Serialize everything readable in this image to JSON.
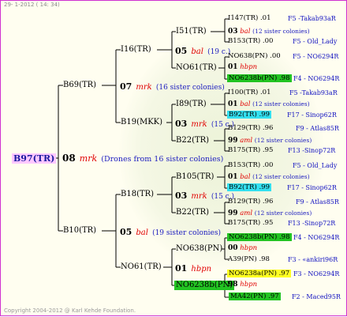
{
  "header": "29-  1-2012 ( 14: 34)",
  "footer": "Copyright 2004-2012 @ Karl Kehde Foundation.",
  "root": {
    "name": "B97(TR)",
    "year": "08",
    "mark": "mrk",
    "note": "(Drones from 16 sister colonies)"
  },
  "gen1": {
    "top": {
      "name": "B69(TR)",
      "year": "07",
      "mark": "mrk",
      "note": "(16 sister colonies)"
    },
    "bottom": {
      "name": "B10(TR)",
      "year": "05",
      "mark": "bal",
      "note": "(19 sister colonies)"
    }
  },
  "gen2": [
    {
      "name": "I16(TR)",
      "year": "05",
      "mark": "bal",
      "note": "(19 c.)"
    },
    {
      "name": "B19(MKK)",
      "year": "03",
      "mark": "mrk",
      "note": "(15 c.)"
    },
    {
      "name": "B18(TR)",
      "year": "03",
      "mark": "mrk",
      "note": "(15 c.)"
    },
    {
      "name": "NO61(TR)",
      "year": "01",
      "mark": "hbpn",
      "note": ""
    }
  ],
  "gen3": [
    "I51(TR)",
    "NO61(TR)",
    "I89(TR)",
    "B22(TR)",
    "B105(TR)",
    "B22(TR)",
    "NO638(PN)",
    "NO6238b(PN)"
  ],
  "rows": [
    {
      "left": "I147(TR) .01",
      "right": "F5 -Takab93aR"
    },
    {
      "year": "03",
      "mark": "bal",
      "note": "(12 sister colonies)"
    },
    {
      "left": "B153(TR) .00",
      "right": "F5 - Old_Lady"
    },
    {
      "left": "NO638(PN) .00",
      "right": "F5 - NO6294R"
    },
    {
      "year": "01",
      "mark": "hbpn",
      "note": ""
    },
    {
      "left": "NO6238b(PN) .98",
      "right": "F4 - NO6294R"
    },
    {
      "left": "I100(TR) .01",
      "right": "F5 -Takab93aR"
    },
    {
      "year": "01",
      "mark": "bal",
      "note": "(12 sister colonies)"
    },
    {
      "left": "B92(TR) .99",
      "right": "F17 - Sinop62R"
    },
    {
      "left": "B129(TR) .96",
      "right": "F9 - Atlas85R"
    },
    {
      "year": "99",
      "mark": "aml",
      "note": "(12 sister colonies)"
    },
    {
      "left": "B175(TR) .95",
      "right": "F13 -Sinop72R"
    },
    {
      "left": "B153(TR) .00",
      "right": "F5 - Old_Lady"
    },
    {
      "year": "01",
      "mark": "bal",
      "note": "(12 sister colonies)"
    },
    {
      "left": "B92(TR) .99",
      "right": "F17 - Sinop62R"
    },
    {
      "left": "B129(TR) .96",
      "right": "F9 - Atlas85R"
    },
    {
      "year": "99",
      "mark": "aml",
      "note": "(12 sister colonies)"
    },
    {
      "left": "B175(TR) .95",
      "right": "F13 -Sinop72R"
    },
    {
      "left": "NO6238b(PN) .98",
      "right": "F4 - NO6294R"
    },
    {
      "year": "00",
      "mark": "hbpn",
      "note": ""
    },
    {
      "left": "A39(PN) .98",
      "right": "F3 - «ankiri96R"
    },
    {
      "left": "NO6238a(PN) .97",
      "right": "F3 - NO6294R"
    },
    {
      "year": "98",
      "mark": "hbpn",
      "note": ""
    },
    {
      "left": "MA42(PN) .97",
      "right": "F2 - Maced95R"
    }
  ]
}
